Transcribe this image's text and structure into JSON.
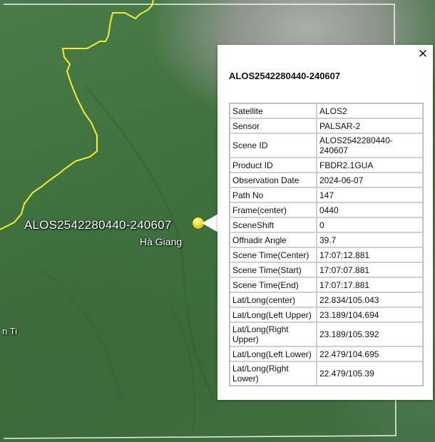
{
  "map": {
    "place_title": "ALOS2542280440-240607",
    "place_subtitle": "Hà Giang",
    "edge_label": "n Ti",
    "border_color": "#f4ee2a",
    "footprint_color": "#ffffff"
  },
  "popup": {
    "title": "ALOS2542280440-240607",
    "close_icon": "close-icon",
    "rows": [
      {
        "key": "Satellite",
        "value": "ALOS2"
      },
      {
        "key": "Sensor",
        "value": "PALSAR-2"
      },
      {
        "key": "Scene ID",
        "value": "ALOS2542280440-240607"
      },
      {
        "key": "Product ID",
        "value": "FBDR2.1GUA"
      },
      {
        "key": "Observation Date",
        "value": "2024-06-07"
      },
      {
        "key": "Path No",
        "value": "147"
      },
      {
        "key": "Frame(center)",
        "value": "0440"
      },
      {
        "key": "SceneShift",
        "value": "0"
      },
      {
        "key": "Offnadir Angle",
        "value": "39.7"
      },
      {
        "key": "Scene Time(Center)",
        "value": "17:07:12.881"
      },
      {
        "key": "Scene Time(Start)",
        "value": "17:07:07.881"
      },
      {
        "key": "Scene Time(End)",
        "value": "17:07:17.881"
      },
      {
        "key": "Lat/Long(center)",
        "value": "22.834/105.043"
      },
      {
        "key": "Lat/Long(Left Upper)",
        "value": "23.189/104.694"
      },
      {
        "key": "Lat/Long(Right Upper)",
        "value": "23.189/105.392"
      },
      {
        "key": "Lat/Long(Left Lower)",
        "value": "22.479/104.695"
      },
      {
        "key": "Lat/Long(Right Lower)",
        "value": "22.479/105.39"
      }
    ]
  }
}
